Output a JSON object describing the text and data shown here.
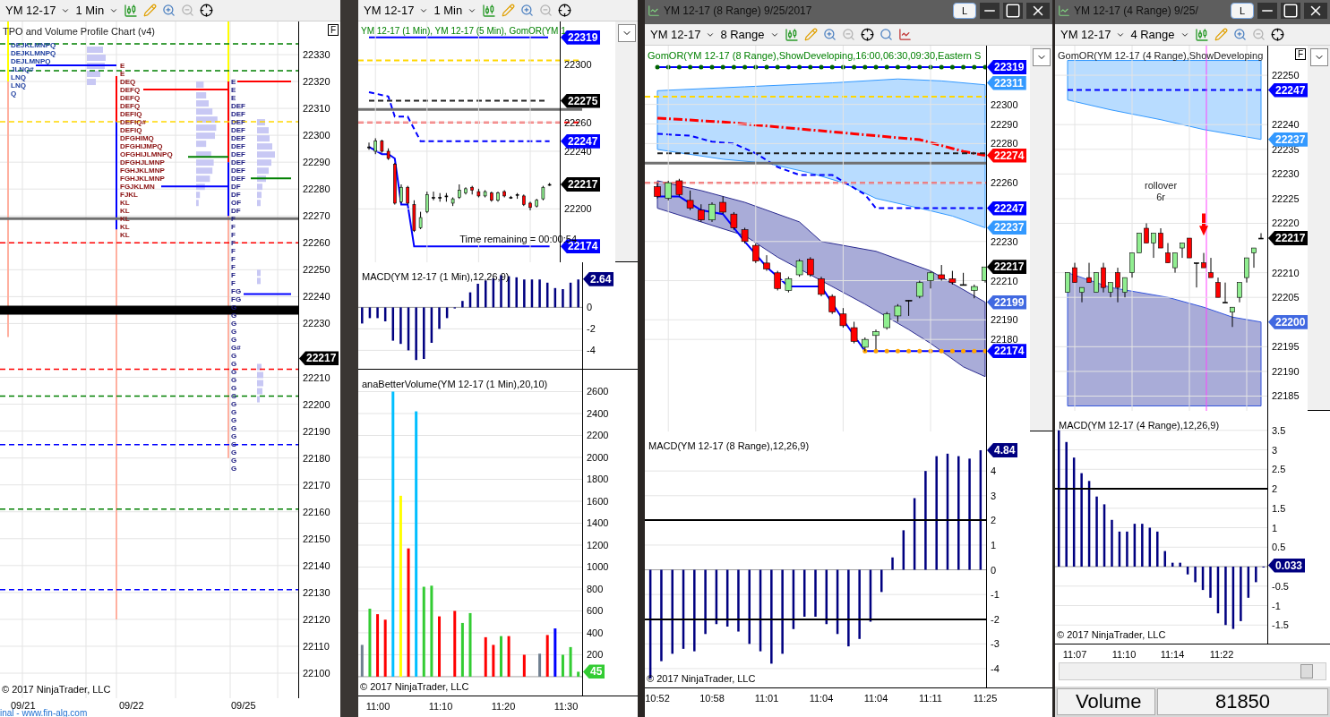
{
  "windows": [
    {
      "kind": "tpo",
      "toolbar": {
        "instrument": "YM 12-17",
        "interval": "1 Min"
      },
      "price_pane": {
        "title": "TPO and Volume Profile Chart (v4)",
        "flag": "F",
        "copyright": "© 2017 NinjaTrader, LLC",
        "axis_labels": [
          "22330",
          "22320",
          "22310",
          "22300",
          "22290",
          "22280",
          "22270",
          "22260",
          "22250",
          "22240",
          "22230",
          "22210",
          "22200",
          "22190",
          "22180",
          "22170",
          "22160",
          "22150",
          "22140",
          "22130",
          "22120",
          "22110",
          "22100"
        ],
        "badges": [
          {
            "text": "22217",
            "color": "#000000"
          }
        ],
        "tpo_columns": [
          [
            "DEJKLMNPQ",
            "DEJKLMNPQ",
            "DEJLMNPQ",
            "JLNQ#",
            "LNQ",
            "LNQ",
            "Q"
          ],
          [
            "E",
            "E",
            "DEQ",
            "DEFQ",
            "DEFQ",
            "DEFQ",
            "DEFIQ",
            "DEFIQ#",
            "DEFIQ",
            "DFGHIMQ",
            "DFGHIJMPQ",
            "OFGHIJLMNPQ",
            "DFGHJLMNP",
            "FGHJKLMNP",
            "FGHJKLMNP",
            "FGJKLMN",
            "FJKL",
            "KL",
            "KL",
            "KL",
            "KL",
            "KL"
          ],
          [
            "E",
            "E",
            "E",
            "DEF",
            "DEF",
            "DEF",
            "DEF",
            "DEF",
            "DEF",
            "DEF",
            "DEF",
            "DEF",
            "DEF",
            "DF",
            "DF",
            "OF",
            "DF",
            "F",
            "F",
            "F",
            "F",
            "F",
            "F",
            "F",
            "F",
            "F",
            "FG",
            "FG",
            "G",
            "G",
            "G",
            "G",
            "G",
            "G#",
            "G",
            "G",
            "G",
            "G",
            "G",
            "G",
            "G",
            "G",
            "G",
            "G",
            "G",
            "G",
            "G",
            "G",
            "G"
          ]
        ]
      },
      "x_axis": [
        "09/21",
        "09/22",
        "09/25"
      ],
      "footer_link": "inal - www.fin-alg.com"
    },
    {
      "kind": "one_minute",
      "toolbar": {
        "instrument": "YM 12-17",
        "interval": "1 Min"
      },
      "price_pane": {
        "title": "YM 12-17 (1 Min), YM 12-17 (5 Min), GomOR(YM 1",
        "note": "Time remaining = 00:00:54",
        "badges": [
          {
            "text": "22319",
            "color": "#0000ff"
          },
          {
            "text": "22275",
            "color": "#000000"
          },
          {
            "text": "22247",
            "color": "#0000ff"
          },
          {
            "text": "22217",
            "color": "#000000"
          },
          {
            "text": "22174",
            "color": "#0000ff"
          }
        ],
        "chart_data": {
          "type": "candlestick",
          "grid": true,
          "ylim": [
            22163,
            22330
          ],
          "yticks": [
            22300,
            22260,
            22240,
            22200
          ],
          "ohlc": [
            [
              22243,
              22246,
              22241,
              22243
            ],
            [
              22240,
              22249,
              22238,
              22247
            ],
            [
              22247,
              22248,
              22239,
              22240
            ],
            [
              22240,
              22242,
              22234,
              22235
            ],
            [
              22231,
              22232,
              22203,
              22204
            ],
            [
              22205,
              22217,
              22204,
              22215
            ],
            [
              22215,
              22216,
              22203,
              22204
            ],
            [
              22203,
              22206,
              22184,
              22185
            ],
            [
              22187,
              22198,
              22186,
              22194
            ],
            [
              22198,
              22212,
              22197,
              22210
            ],
            [
              22208,
              22212,
              22206,
              22208
            ],
            [
              22208,
              22211,
              22205,
              22208
            ],
            [
              22209,
              22211,
              22205,
              22209
            ],
            [
              22204,
              22208,
              22202,
              22207
            ],
            [
              22208,
              22217,
              22207,
              22213
            ],
            [
              22211,
              22215,
              22210,
              22214
            ],
            [
              22215,
              22216,
              22210,
              22213
            ],
            [
              22212,
              22214,
              22208,
              22209
            ],
            [
              22209,
              22213,
              22208,
              22212
            ],
            [
              22211,
              22212,
              22205,
              22206
            ],
            [
              22206,
              22212,
              22205,
              22211
            ],
            [
              22212,
              22213,
              22208,
              22209
            ],
            [
              22208,
              22209,
              22207,
              22208
            ],
            [
              22210,
              22211,
              22207,
              22210
            ],
            [
              22209,
              22210,
              22202,
              22203
            ],
            [
              22204,
              22205,
              22199,
              22201
            ],
            [
              22202,
              22207,
              22201,
              22206
            ],
            [
              22207,
              22216,
              22206,
              22215
            ],
            [
              22217,
              22218,
              22216,
              22217
            ]
          ]
        }
      },
      "macd_pane": {
        "title": "MACD(YM 12-17 (1 Min),12,26,9)",
        "badge": {
          "text": "2.64",
          "color": "#000080"
        },
        "chart_data": {
          "type": "bar",
          "grid": true,
          "ylim": [
            -5.8,
            4.2
          ],
          "yticks": [
            0,
            -2,
            -4
          ],
          "values": [
            -1.5,
            -1,
            -1,
            -1.3,
            -3.1,
            -3.4,
            -4,
            -4.9,
            -4.8,
            -3.3,
            -2,
            -1,
            -0.1,
            0.6,
            1.4,
            2.2,
            2.5,
            2.7,
            3,
            2.9,
            2.8,
            2.6,
            2.6,
            2.6,
            2.3,
            1.8,
            1.7,
            2.3,
            2.6
          ]
        }
      },
      "volume_pane": {
        "title": "anaBetterVolume(YM 12-17 (1 Min),20,10)",
        "copyright": "© 2017 NinjaTrader, LLC",
        "badge": {
          "text": "45",
          "color": "#33cc33"
        },
        "time_labels": [
          "11:00",
          "11:10",
          "11:20",
          "11:30"
        ],
        "chart_data": {
          "type": "bar",
          "grid": true,
          "ylim": [
            -180,
            2800
          ],
          "yticks": [
            200,
            400,
            600,
            800,
            1000,
            1200,
            1400,
            1600,
            1800,
            2000,
            2200,
            2400,
            2600
          ],
          "values": [
            290,
            620,
            570,
            520,
            2600,
            1650,
            1170,
            2420,
            820,
            830,
            550,
            null,
            600,
            490,
            580,
            null,
            360,
            290,
            370,
            370,
            null,
            200,
            null,
            210,
            380,
            440,
            200,
            270,
            45
          ],
          "colors": [
            "#708090",
            "#33cc33",
            "#ff0000",
            "#ff0000",
            "#00bfff",
            "#ffff00",
            "#ff0000",
            "#00bfff",
            "#33cc33",
            "#33cc33",
            "#ff0000",
            null,
            "#ff0000",
            "#33cc33",
            "#33cc33",
            null,
            "#ff0000",
            "#ff0000",
            "#33cc33",
            "#ff0000",
            null,
            "#ff0000",
            null,
            "#708090",
            "#ff0000",
            "#0000ff",
            "#33cc33",
            "#33cc33",
            "#33cc33"
          ]
        }
      }
    },
    {
      "kind": "eight_range",
      "title_bar": {
        "title": "YM 12-17 (8 Range)  9/25/2017",
        "button": "L"
      },
      "toolbar": {
        "instrument": "YM 12-17",
        "interval": "8 Range"
      },
      "price_pane": {
        "title": "GomOR(YM 12-17 (8 Range),ShowDeveloping,16:00,06:30,09:30,Eastern S",
        "badges": [
          {
            "text": "22319",
            "color": "#0000ff"
          },
          {
            "text": "22311",
            "color": "#3399ff"
          },
          {
            "text": "22274",
            "color": "#ff0000"
          },
          {
            "text": "22247",
            "color": "#0000ff"
          },
          {
            "text": "22237",
            "color": "#3399ff"
          },
          {
            "text": "22217",
            "color": "#000000"
          },
          {
            "text": "22199",
            "color": "#4169e1"
          },
          {
            "text": "22174",
            "color": "#0000ff"
          }
        ],
        "chart_data": {
          "type": "candlestick",
          "grid": true,
          "ylim": [
            22133,
            22330
          ],
          "yticks": [
            22300,
            22290,
            22280,
            22260,
            22230,
            22210,
            22190,
            22180
          ],
          "ohlc": [
            [
              22258,
              22260,
              22252,
              22253
            ],
            [
              22252,
              22261,
              22251,
              22260
            ],
            [
              22261,
              22262,
              22253,
              22254
            ],
            [
              22251,
              22256,
              22246,
              22247
            ],
            [
              22246,
              22249,
              22240,
              22241
            ],
            [
              22241,
              22250,
              22240,
              22249
            ],
            [
              22250,
              22253,
              22244,
              22245
            ],
            [
              22244,
              22245,
              22236,
              22237
            ],
            [
              22236,
              22237,
              22229,
              22230
            ],
            [
              22228,
              22229,
              22219,
              22220
            ],
            [
              22219,
              22223,
              22215,
              22216
            ],
            [
              22214,
              22215,
              22205,
              22206
            ],
            [
              22205,
              22212,
              22204,
              22211
            ],
            [
              22213,
              22221,
              22212,
              22220
            ],
            [
              22221,
              22222,
              22212,
              22213
            ],
            [
              22211,
              22212,
              22202,
              22203
            ],
            [
              22202,
              22203,
              22193,
              22194
            ],
            [
              22193,
              22196,
              22186,
              22187
            ],
            [
              22186,
              22189,
              22178,
              22179
            ],
            [
              22176,
              22181,
              22174,
              22180
            ],
            [
              22182,
              22185,
              22175,
              22184
            ],
            [
              22186,
              22194,
              22185,
              22193
            ],
            [
              22192,
              22198,
              22189,
              22197
            ],
            [
              22200,
              22200,
              22192,
              22200
            ],
            [
              22202,
              22210,
              22201,
              22209
            ],
            [
              22210,
              22215,
              22206,
              22214
            ],
            [
              22213,
              22218,
              22210,
              22211
            ],
            [
              22211,
              22215,
              22208,
              22209
            ],
            [
              22208,
              22214,
              22208,
              22208
            ],
            [
              22205,
              22208,
              22201,
              22207
            ],
            [
              22210,
              22217,
              22209,
              22217
            ]
          ]
        }
      },
      "macd_pane": {
        "title": "MACD(YM 12-17 (8 Range),12,26,9)",
        "copyright": "© 2017 NinjaTrader, LLC",
        "badge": {
          "text": "4.84",
          "color": "#000080"
        },
        "time_labels": [
          "10:52",
          "10:58",
          "11:01",
          "11:04",
          "11:04",
          "11:11",
          "11:25"
        ],
        "chart_data": {
          "type": "bar",
          "grid": true,
          "ylim": [
            -4.8,
            5.6
          ],
          "yticks": [
            4,
            3,
            2,
            1,
            0,
            -1,
            -2,
            -3,
            -4
          ],
          "values": [
            -4.4,
            -3.7,
            -3.4,
            -3.2,
            -3.3,
            -2.6,
            -2.2,
            -2.3,
            -2.5,
            -3,
            -3.3,
            -3.8,
            -3.4,
            -2.4,
            -1.9,
            -1.9,
            -2.2,
            -2.6,
            -3.1,
            -2.8,
            -2.1,
            -0.9,
            0.5,
            1.6,
            2.9,
            4,
            4.6,
            4.7,
            4.6,
            4.5,
            4.84
          ]
        }
      }
    },
    {
      "kind": "four_range",
      "title_bar": {
        "title": "YM 12-17 (4 Range)  9/25/",
        "button": "L"
      },
      "toolbar": {
        "instrument": "YM 12-17",
        "interval": "4 Range"
      },
      "price_pane": {
        "title": "GomOR(YM 12-17 (4 Range),ShowDeveloping",
        "flag": "F",
        "annotation": "rollover",
        "annotation_sub": "6r",
        "badges": [
          {
            "text": "22247",
            "color": "#0000ff"
          },
          {
            "text": "22237",
            "color": "#3399ff"
          },
          {
            "text": "22217",
            "color": "#000000"
          },
          {
            "text": "22200",
            "color": "#4169e1"
          }
        ],
        "chart_data": {
          "type": "candlestick",
          "grid": true,
          "ylim": [
            22182,
            22256
          ],
          "yticks": [
            22250,
            22240,
            22235,
            22230,
            22225,
            22220,
            22210,
            22205,
            22195,
            22190,
            22185
          ],
          "ohlc": [
            [
              22206,
              22210,
              22206,
              22210
            ],
            [
              22211,
              22212,
              22208,
              22208
            ],
            [
              22206,
              22207,
              22204,
              22207
            ],
            [
              22209,
              22212,
              22208,
              22208
            ],
            [
              22206,
              22210,
              22206,
              22210
            ],
            [
              22211,
              22212,
              22206,
              22207
            ],
            [
              22206,
              22208,
              22205,
              22208
            ],
            [
              22210,
              22211,
              22204,
              22207
            ],
            [
              22206,
              22209,
              22205,
              22209
            ],
            [
              22210,
              22214,
              22209,
              22214
            ],
            [
              22214,
              22218,
              22214,
              22218
            ],
            [
              22219,
              22220,
              22216,
              22216
            ],
            [
              22216,
              22218,
              22213,
              22218
            ],
            [
              22218,
              22219,
              22215,
              22215
            ],
            [
              22214,
              22216,
              22212,
              22212
            ],
            [
              22211,
              22214,
              22210,
              22214
            ],
            [
              22215,
              22216,
              22213,
              22216
            ],
            [
              22217,
              22217,
              22213,
              22213
            ],
            [
              22212,
              22212,
              22207,
              22212
            ],
            [
              22212,
              22214,
              22211,
              22211
            ],
            [
              22210,
              22213,
              22209,
              22209
            ],
            [
              22208,
              22209,
              22205,
              22205
            ],
            [
              22204,
              22208,
              22204,
              22204
            ],
            [
              22202,
              22203,
              22199,
              22203
            ],
            [
              22205,
              22208,
              22204,
              22208
            ],
            [
              22209,
              22213,
              22208,
              22213
            ],
            [
              22214,
              22215,
              22211,
              22215
            ],
            [
              22217,
              22218,
              22217,
              22217
            ]
          ]
        }
      },
      "macd_pane": {
        "title": "MACD(YM 12-17 (4 Range),12,26,9)",
        "copyright": "© 2017 NinjaTrader, LLC",
        "badge": {
          "text": "0.033",
          "color": "#000080"
        },
        "time_labels": [
          "11:07",
          "11:10",
          "11:14",
          "11:22"
        ],
        "chart_data": {
          "type": "bar",
          "grid": true,
          "ylim": [
            -2,
            4
          ],
          "yticks": [
            3.5,
            3,
            2.5,
            2,
            1.5,
            1,
            0.5,
            -0.5,
            -1,
            -1.5
          ],
          "values": [
            3.5,
            3.2,
            2.8,
            2.4,
            2.2,
            1.8,
            1.6,
            1.2,
            0.9,
            0.9,
            1.1,
            1.1,
            1,
            0.9,
            0.4,
            0.1,
            0.1,
            -0.2,
            -0.4,
            -0.6,
            -0.8,
            -1.2,
            -1.5,
            -1.6,
            -1.4,
            -0.8,
            -0.4,
            0
          ]
        }
      }
    }
  ],
  "status": {
    "label": "Volume",
    "value": "81850"
  }
}
